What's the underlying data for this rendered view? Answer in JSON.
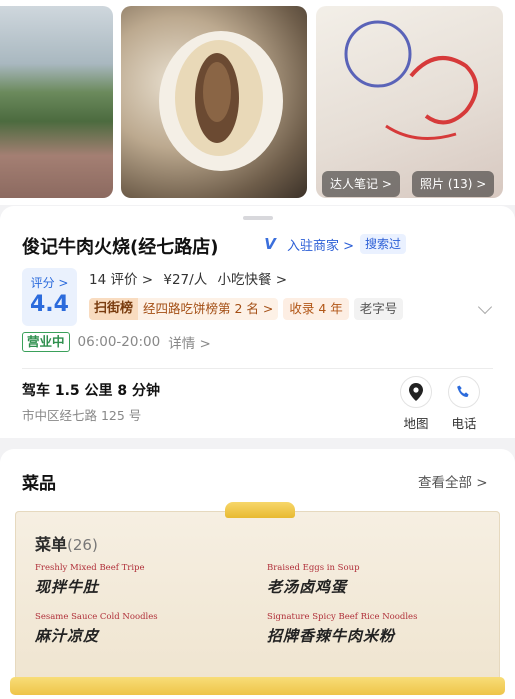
{
  "photos": {
    "notes_badge": "达人笔记 >",
    "photos_badge": "照片 (13) >"
  },
  "shop": {
    "name": "俊记牛肉火烧(经七路店)",
    "verified": "入驻商家 >",
    "search_tag": "搜索过",
    "rating_label": "评分 >",
    "rating_value": "4.4",
    "reviews": "14 评价 >",
    "price": "¥27/人",
    "category": "小吃快餐 >",
    "rank_logo": "扫街榜",
    "rank_text": "经四路吃饼榜第 2 名 >",
    "collected": "收录 4 年",
    "old_brand": "老字号",
    "status": "营业中",
    "hours": "06:00-20:00",
    "details": "详情 >",
    "drive": "驾车 1.5 公里 8 分钟",
    "address": "市中区经七路 125 号",
    "map_label": "地图",
    "call_label": "电话"
  },
  "dishes": {
    "title": "菜品",
    "see_all": "查看全部 >",
    "menu_title": "菜单",
    "menu_count": "(26)",
    "items": [
      {
        "en": "Freshly Mixed Beef Tripe",
        "cn": "现拌牛肚"
      },
      {
        "en": "Braised Eggs in Soup",
        "cn": "老汤卤鸡蛋"
      },
      {
        "en": "Sesame Sauce Cold Noodles",
        "cn": "麻汁凉皮"
      },
      {
        "en": "Signature Spicy Beef Rice Noodles",
        "cn": "招牌香辣牛肉米粉"
      }
    ]
  },
  "colors": {
    "accent_blue": "#2c6bdc",
    "open_green": "#2e8f4d",
    "rank_orange": "#a34e14"
  }
}
